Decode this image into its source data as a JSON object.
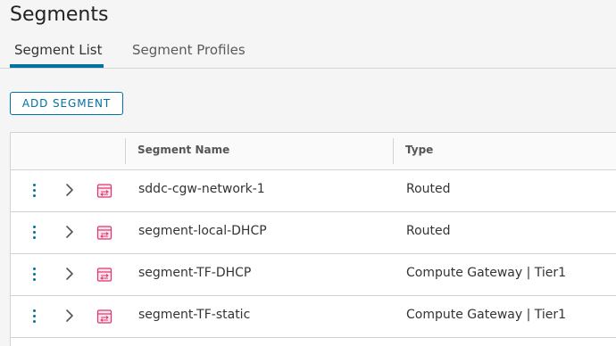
{
  "page": {
    "title": "Segments"
  },
  "tabs": [
    {
      "label": "Segment List",
      "active": true
    },
    {
      "label": "Segment Profiles",
      "active": false
    }
  ],
  "toolbar": {
    "add_label": "ADD SEGMENT"
  },
  "grid": {
    "columns": [
      "Segment Name",
      "Type"
    ],
    "rows": [
      {
        "name": "sddc-cgw-network-1",
        "type": "Routed",
        "icon": "segment-icon"
      },
      {
        "name": "segment-local-DHCP",
        "type": "Routed",
        "icon": "segment-icon"
      },
      {
        "name": "segment-TF-DHCP",
        "type": "Compute Gateway | Tier1",
        "icon": "segment-icon"
      },
      {
        "name": "segment-TF-static",
        "type": "Compute Gateway | Tier1",
        "icon": "segment-icon"
      }
    ]
  },
  "colors": {
    "accent": "#0072a3",
    "segment_icon": "#e0336f",
    "background": "#f5f5f5"
  }
}
